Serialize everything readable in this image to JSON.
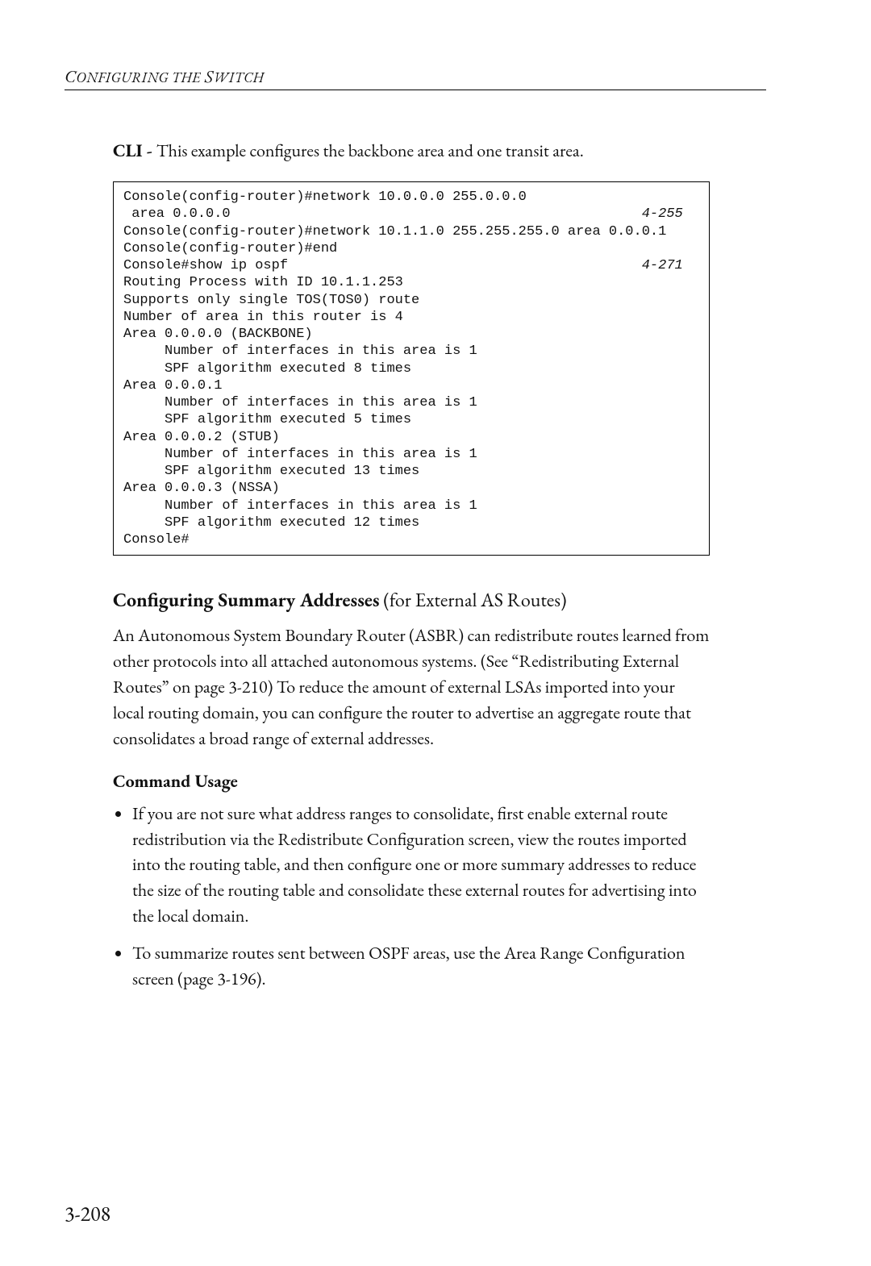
{
  "header": {
    "running_title": "Configuring the Switch"
  },
  "intro": {
    "lead": "CLI - ",
    "text": "This example configures the backbone area and one transit area."
  },
  "code": {
    "lines": [
      {
        "text": "Console(config-router)#network 10.0.0.0 255.0.0.0"
      },
      {
        "text": " area 0.0.0.0",
        "ref": "4-255"
      },
      {
        "text": "Console(config-router)#network 10.1.1.0 255.255.255.0 area 0.0.0.1"
      },
      {
        "text": "Console(config-router)#end"
      },
      {
        "text": "Console#show ip ospf",
        "ref": "4-271"
      },
      {
        "text": "Routing Process with ID 10.1.1.253"
      },
      {
        "text": "Supports only single TOS(TOS0) route"
      },
      {
        "text": "Number of area in this router is 4"
      },
      {
        "text": "Area 0.0.0.0 (BACKBONE)"
      },
      {
        "text": "     Number of interfaces in this area is 1"
      },
      {
        "text": "     SPF algorithm executed 8 times"
      },
      {
        "text": "Area 0.0.0.1"
      },
      {
        "text": "     Number of interfaces in this area is 1"
      },
      {
        "text": "     SPF algorithm executed 5 times"
      },
      {
        "text": "Area 0.0.0.2 (STUB)"
      },
      {
        "text": "     Number of interfaces in this area is 1"
      },
      {
        "text": "     SPF algorithm executed 13 times"
      },
      {
        "text": "Area 0.0.0.3 (NSSA)"
      },
      {
        "text": "     Number of interfaces in this area is 1"
      },
      {
        "text": "     SPF algorithm executed 12 times"
      },
      {
        "text": "Console#"
      }
    ],
    "ref_col": 63
  },
  "section": {
    "title": "Configuring Summary Addresses",
    "subtitle": " (for External AS Routes)",
    "body": "An Autonomous System Boundary Router (ASBR) can redistribute routes learned from other protocols into all attached autonomous systems. (See “Redistributing External Routes” on page 3-210) To reduce the amount of external LSAs imported into your local routing domain, you can configure the router to advertise an aggregate route that consolidates a broad range of external addresses.",
    "usage_heading": "Command Usage",
    "bullets": [
      "If you are not sure what address ranges to consolidate, first enable external route redistribution via the Redistribute Configuration screen, view the routes imported into the routing table, and then configure one or more summary addresses to reduce the size of the routing table and consolidate these external routes for advertising into the local domain.",
      "To summarize routes sent between OSPF areas, use the Area Range Configuration screen (page 3-196)."
    ]
  },
  "page_number": "3-208"
}
